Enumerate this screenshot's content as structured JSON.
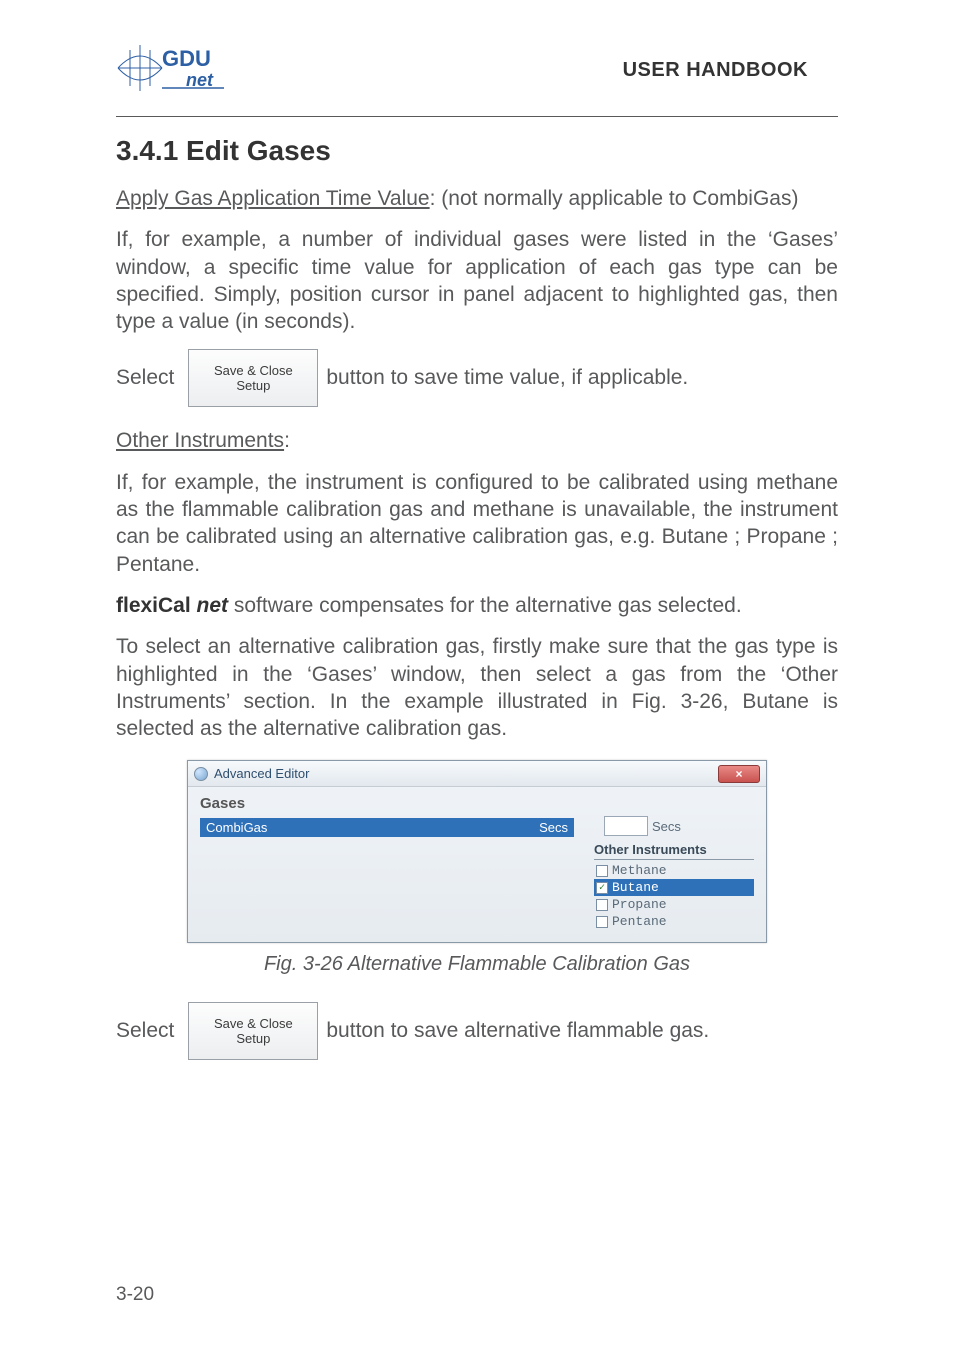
{
  "header": {
    "logo_text_top": "GDU",
    "logo_text_bottom": "net",
    "doc_title": "USER HANDBOOK"
  },
  "section": {
    "heading": "3.4.1  Edit Gases"
  },
  "para1": {
    "lead_underlined": "Apply Gas Application Time Value",
    "lead_rest": ": (not normally applicable to CombiGas)"
  },
  "para2": "If, for example, a number of individual gases were listed in the ‘Gases’ window, a specific time value for application of each gas type can be specified. Simply, position cursor in panel adjacent to highlighted gas, then type a value (in seconds).",
  "inline1": {
    "prefix": "Select",
    "btn_line1": "Save & Close",
    "btn_line2": "Setup",
    "suffix": " button to save time value, if applicable."
  },
  "para3_label": "Other Instruments",
  "para3_colon": ":",
  "para4": "If, for example, the instrument is configured to be calibrated using methane as the flammable calibration gas and methane is unavailable, the instrument can be calibrated using an alternative calibration gas, e.g.  Butane ; Propane ; Pentane.",
  "para5_prefix": "flexiCal ",
  "para5_italic": "net",
  "para5_rest": " software compensates for the alternative gas selected.",
  "para6": "To select an alternative calibration gas, firstly make sure that the gas type is highlighted in the ‘Gases’ window, then select a gas from the ‘Other Instruments’ section. In the example illustrated in Fig. 3-26, Butane is selected as the alternative calibration gas.",
  "screenshot": {
    "title": "Advanced Editor",
    "close_glyph": "×",
    "gases_heading": "Gases",
    "row_name": "CombiGas",
    "row_secs_label": "Secs",
    "input_secs_label": "Secs",
    "other_heading": "Other Instruments",
    "items": [
      {
        "label": "Methane",
        "checked": false,
        "selected": false
      },
      {
        "label": "Butane",
        "checked": true,
        "selected": true
      },
      {
        "label": "Propane",
        "checked": false,
        "selected": false
      },
      {
        "label": "Pentane",
        "checked": false,
        "selected": false
      }
    ]
  },
  "fig_caption": "Fig. 3-26  Alternative Flammable Calibration Gas",
  "inline2": {
    "prefix": "Select",
    "btn_line1": "Save & Close",
    "btn_line2": "Setup",
    "suffix": " button to save alternative flammable gas."
  },
  "page_number": "3-20",
  "colors": {
    "highlight_blue": "#2f71b8",
    "body_gray": "#58595b"
  }
}
